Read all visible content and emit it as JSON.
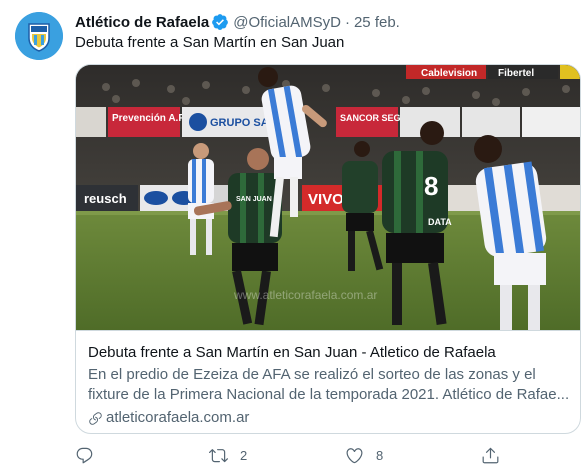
{
  "tweet": {
    "author_name": "Atlético de Rafaela",
    "handle": "@OficialAMSyD",
    "separator": "·",
    "date": "25 feb.",
    "text": "Debuta frente a San Martín en San Juan"
  },
  "card": {
    "title": "Debuta frente a San Martín en San Juan - Atletico de Rafaela",
    "description": "En el predio de Ezeiza de AFA se realizó el sorteo de las zonas y el fixture de la Primera Nacional de la temporada 2021.  Atlético de Rafae...",
    "domain": "atleticorafaela.com.ar",
    "image": {
      "watermark": "www.atleticorafaela.com.ar",
      "banners": [
        "Cablevision",
        "Fibertel",
        "Prevención A.R.T.",
        "GRUPO SANCOR",
        "SANCOR SEGUROS",
        "reusch",
        "VIVO"
      ],
      "jersey_text": [
        "SAN JUAN",
        "8",
        "DATA"
      ]
    }
  },
  "actions": {
    "reply_count": "",
    "retweet_count": "2",
    "like_count": "8",
    "share_count": ""
  },
  "colors": {
    "verified": "#1d9bf0",
    "text_primary": "#0f1419",
    "text_secondary": "#536471",
    "border": "#cfd9de"
  },
  "icons": [
    "club-crest-icon",
    "verified-badge-icon",
    "link-icon",
    "reply-icon",
    "retweet-icon",
    "like-icon",
    "share-icon"
  ]
}
